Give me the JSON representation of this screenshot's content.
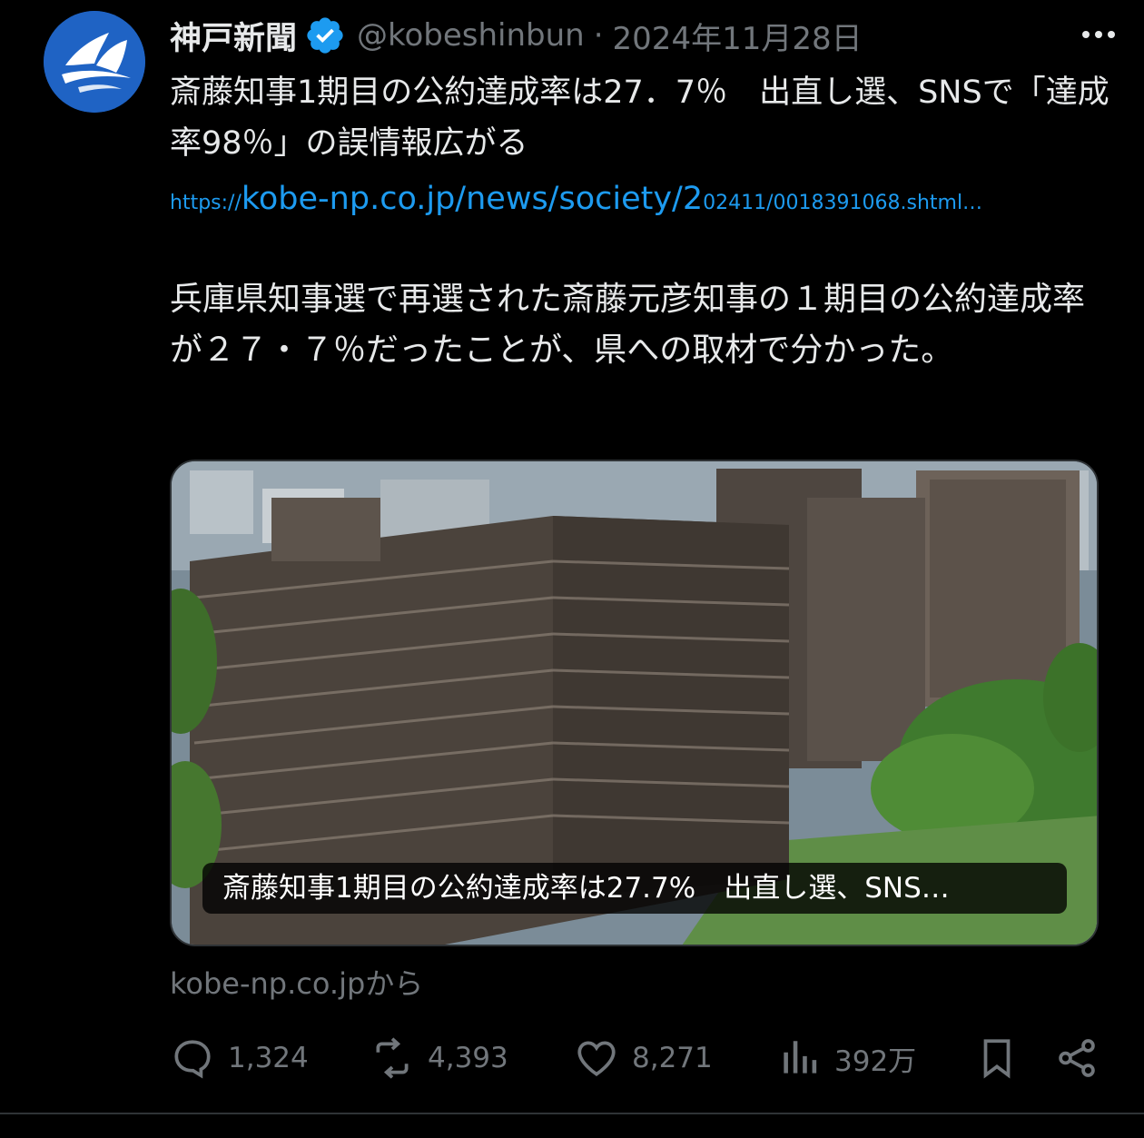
{
  "account": {
    "name": "神戸新聞",
    "handle": "@kobeshinbun",
    "separator": "·",
    "date": "2024年11月28日",
    "verified_icon": "verified-badge-icon",
    "avatar_icon": "kobe-shinbun-logo"
  },
  "tweet": {
    "headline": "斎藤知事1期目の公約達成率は27．7％　出直し選、SNSで「達成率98％」の誤情報広がる",
    "link": {
      "prefix": "https://",
      "main": "kobe-np.co.jp/news/society/2",
      "suffix": "02411/0018391068.shtml…"
    },
    "body": "兵庫県知事選で再選された斎藤元彦知事の１期目の公約達成率が２７・７％だったことが、県への取材で分かった。"
  },
  "card": {
    "caption": "斎藤知事1期目の公約達成率は27.7%　出直し選、SNS…",
    "source": "kobe-np.co.jpから"
  },
  "actions": {
    "replies": "1,324",
    "reposts": "4,393",
    "likes": "8,271",
    "views": "392万"
  },
  "colors": {
    "background": "#000000",
    "text": "#e7e9ea",
    "muted": "#71767b",
    "link": "#1d9bf0",
    "verified": "#1d9bf0"
  }
}
